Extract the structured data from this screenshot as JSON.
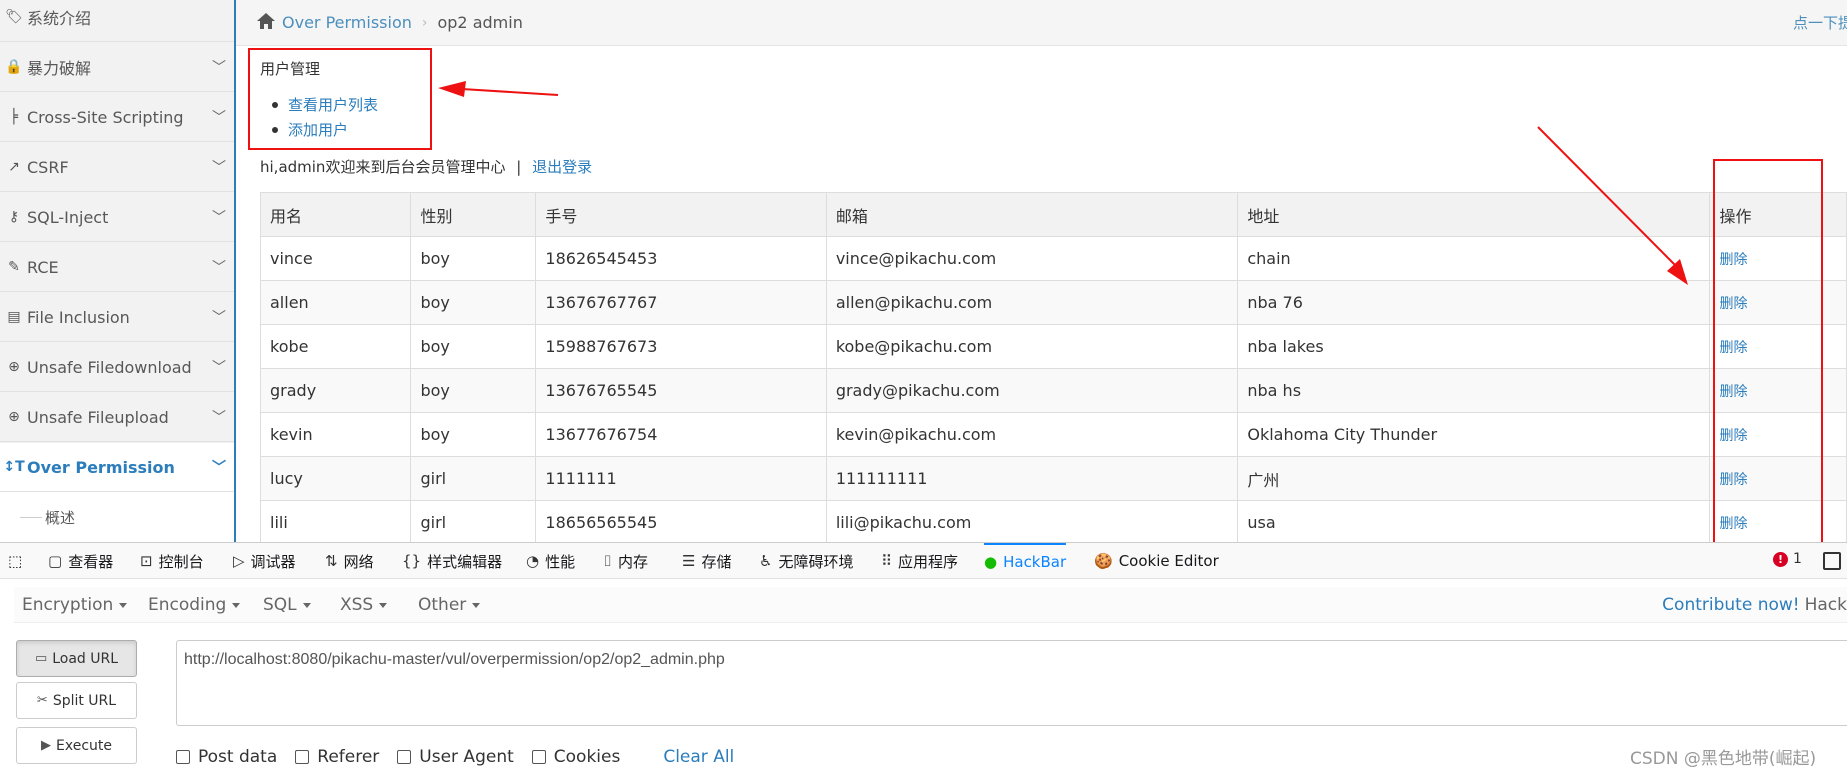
{
  "sidebar": {
    "items": [
      {
        "label": "系统介绍",
        "icon": "tags-icon"
      },
      {
        "label": "暴力破解",
        "icon": "lock-icon"
      },
      {
        "label": "Cross-Site Scripting",
        "icon": "sitemap-icon"
      },
      {
        "label": "CSRF",
        "icon": "share-icon"
      },
      {
        "label": "SQL-Inject",
        "icon": "key-icon"
      },
      {
        "label": "RCE",
        "icon": "pencil-icon"
      },
      {
        "label": "File Inclusion",
        "icon": "file-icon"
      },
      {
        "label": "Unsafe Filedownload",
        "icon": "download-icon"
      },
      {
        "label": "Unsafe Fileupload",
        "icon": "upload-icon"
      },
      {
        "label": "Over Permission",
        "icon": "text-height-icon",
        "active": true
      }
    ],
    "sub_item": "概述",
    "accent_color": "#2b7dbc"
  },
  "breadcrumb": {
    "link": "Over Permission",
    "current": "op2 admin",
    "right_link": "点一下提"
  },
  "management": {
    "title": "用户管理",
    "links": [
      "查看用户列表",
      "添加用户"
    ]
  },
  "welcome": {
    "text": "hi,admin欢迎来到后台会员管理中心",
    "separator": "|",
    "logout": "退出登录"
  },
  "table": {
    "headers": [
      "用名",
      "性别",
      "手号",
      "邮箱",
      "地址",
      "操作"
    ],
    "rows": [
      [
        "vince",
        "boy",
        "18626545453",
        "vince@pikachu.com",
        "chain",
        "删除"
      ],
      [
        "allen",
        "boy",
        "13676767767",
        "allen@pikachu.com",
        "nba 76",
        "删除"
      ],
      [
        "kobe",
        "boy",
        "15988767673",
        "kobe@pikachu.com",
        "nba lakes",
        "删除"
      ],
      [
        "grady",
        "boy",
        "13676765545",
        "grady@pikachu.com",
        "nba hs",
        "删除"
      ],
      [
        "kevin",
        "boy",
        "13677676754",
        "kevin@pikachu.com",
        "Oklahoma City Thunder",
        "删除"
      ],
      [
        "lucy",
        "girl",
        "1111111",
        "111111111",
        "广州",
        "删除"
      ],
      [
        "lili",
        "girl",
        "18656565545",
        "lili@pikachu.com",
        "usa",
        "删除"
      ]
    ]
  },
  "annotation_color": "#ee1111",
  "devtools": {
    "tabs": [
      {
        "label": "查看器",
        "icon": "inspector-icon"
      },
      {
        "label": "控制台",
        "icon": "console-icon"
      },
      {
        "label": "调试器",
        "icon": "debugger-icon"
      },
      {
        "label": "网络",
        "icon": "network-icon"
      },
      {
        "label": "样式编辑器",
        "icon": "style-editor-icon"
      },
      {
        "label": "性能",
        "icon": "performance-icon"
      },
      {
        "label": "内存",
        "icon": "memory-icon"
      },
      {
        "label": "存储",
        "icon": "storage-icon"
      },
      {
        "label": "无障碍环境",
        "icon": "accessibility-icon"
      },
      {
        "label": "应用程序",
        "icon": "application-icon"
      },
      {
        "label": "HackBar",
        "icon": "hackbar-icon",
        "active": true
      },
      {
        "label": "Cookie Editor",
        "icon": "cookie-icon"
      }
    ],
    "error_count": "1"
  },
  "hackbar": {
    "menu": [
      "Encryption",
      "Encoding",
      "SQL",
      "XSS",
      "Other"
    ],
    "contribute": "Contribute now!",
    "contribute_suffix": "Hack",
    "buttons": [
      "Load URL",
      "Split URL",
      "Execute"
    ],
    "url": "http://localhost:8080/pikachu-master/vul/overpermission/op2/op2_admin.php",
    "options": [
      "Post data",
      "Referer",
      "User Agent",
      "Cookies"
    ],
    "clear_all": "Clear All"
  },
  "watermark": "CSDN @黑色地带(崛起)"
}
